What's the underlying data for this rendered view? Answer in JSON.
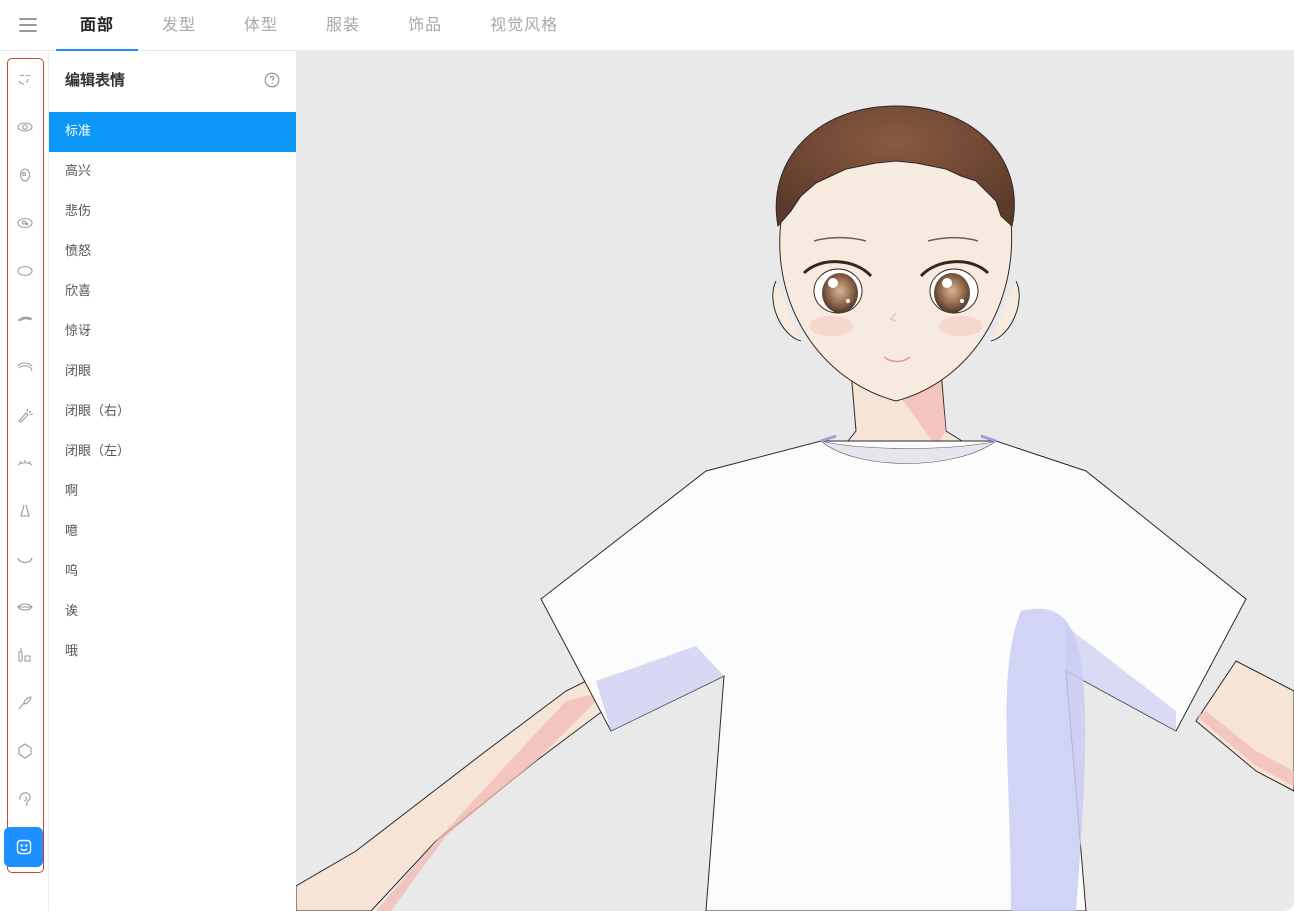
{
  "header": {
    "tabs": [
      {
        "label": "面部",
        "active": true
      },
      {
        "label": "发型",
        "active": false
      },
      {
        "label": "体型",
        "active": false
      },
      {
        "label": "服装",
        "active": false
      },
      {
        "label": "饰品",
        "active": false
      },
      {
        "label": "视觉风格",
        "active": false
      }
    ]
  },
  "rail": {
    "icons": [
      "face-shape-icon",
      "eye-icon",
      "iris-icon",
      "eye-highlight-icon",
      "eye-white-icon",
      "eyebrow-icon",
      "eyelash-upper-icon",
      "eyelash-icon",
      "eyelash-lower-icon",
      "nose-icon",
      "mouth-icon",
      "lips-icon",
      "teeth-icon",
      "makeup-brush-icon",
      "face-outline-icon",
      "ear-icon",
      "expression-icon"
    ],
    "active_index": 16,
    "highlight_color": "#c9432f"
  },
  "panel": {
    "title": "编辑表情",
    "items": [
      {
        "label": "标准",
        "active": true
      },
      {
        "label": "高兴"
      },
      {
        "label": "悲伤"
      },
      {
        "label": "愤怒"
      },
      {
        "label": "欣喜"
      },
      {
        "label": "惊讶"
      },
      {
        "label": "闭眼"
      },
      {
        "label": "闭眼（右）"
      },
      {
        "label": "闭眼（左）"
      },
      {
        "label": "啊"
      },
      {
        "label": "噫"
      },
      {
        "label": "呜"
      },
      {
        "label": "诶"
      },
      {
        "label": "哦"
      }
    ]
  },
  "colors": {
    "accent": "#1e8fff",
    "list_active": "#0a97f7",
    "viewport_bg": "#e9e9e9"
  }
}
